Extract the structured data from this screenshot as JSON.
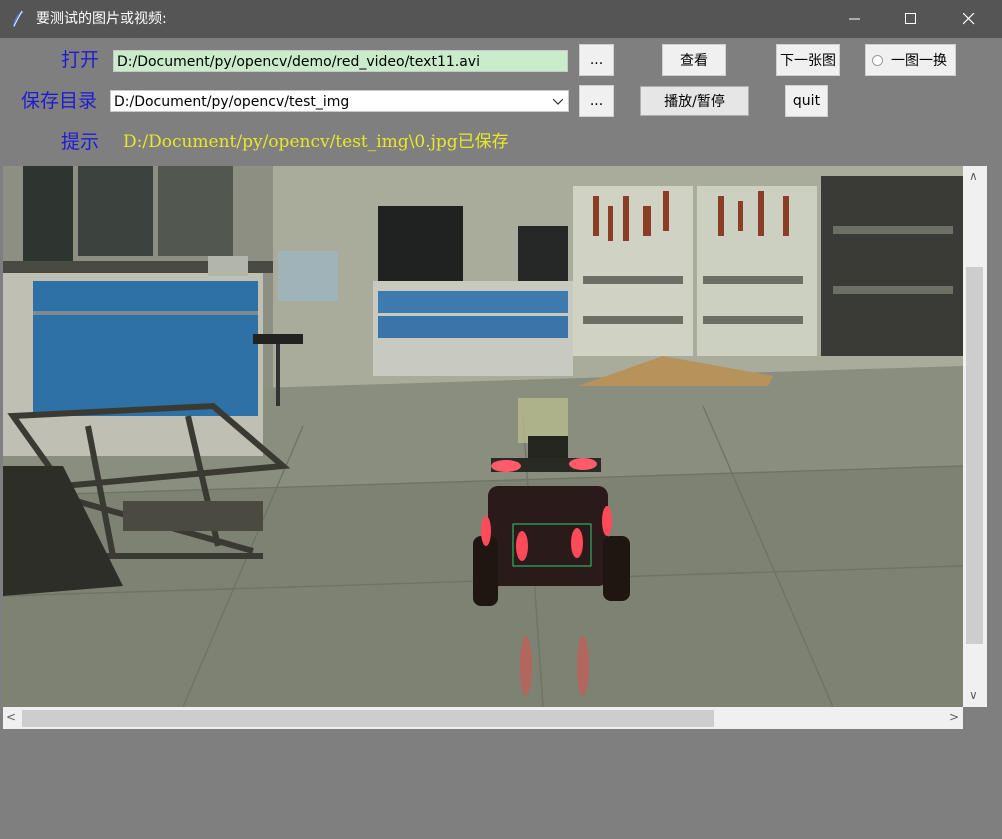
{
  "window": {
    "title": "要测试的图片或视频:"
  },
  "form": {
    "open_label": "打开",
    "open_path": "D:/Document/py/opencv/demo/red_video/text11.avi",
    "save_label": "保存目录",
    "save_path": "D:/Document/py/opencv/test_img",
    "hint_label": "提示",
    "hint_text": "D:/Document/py/opencv/test_img\\0.jpg已保存"
  },
  "buttons": {
    "browse_open": "...",
    "browse_save": "...",
    "view": "查看",
    "next_image": "下一张图",
    "play_pause": "播放/暂停",
    "quit": "quit",
    "one_by_one": "一图一换"
  },
  "colors": {
    "label": "#1c1cd4",
    "hint": "#e8e82a",
    "path_bg": "#c9eccb",
    "window_bg": "#7f7f7f"
  }
}
